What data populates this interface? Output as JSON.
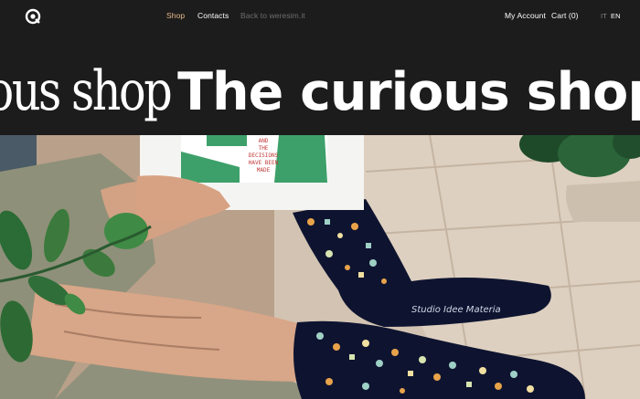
{
  "nav": {
    "logo_icon": "studio-logo-icon",
    "shop": "Shop",
    "contacts": "Contacts",
    "back": "Back to weresim.it",
    "account": "My Account",
    "cart": "Cart (0)",
    "lang_it": "IT",
    "lang_en": "EN"
  },
  "hero": {
    "serif_text": "curious shop",
    "sans_text": "The curious shop"
  },
  "photo": {
    "card_text": [
      "AND",
      "THE",
      "DECISIONS",
      "HAVE BEEN",
      "MADE"
    ],
    "sock_label": "Studio Idee Materia"
  },
  "colors": {
    "background": "#1c1c1c",
    "nav_active": "#e8b98a",
    "nav_text": "#ffffff",
    "nav_muted": "#6e6e6e",
    "sock": "#0e1430"
  }
}
